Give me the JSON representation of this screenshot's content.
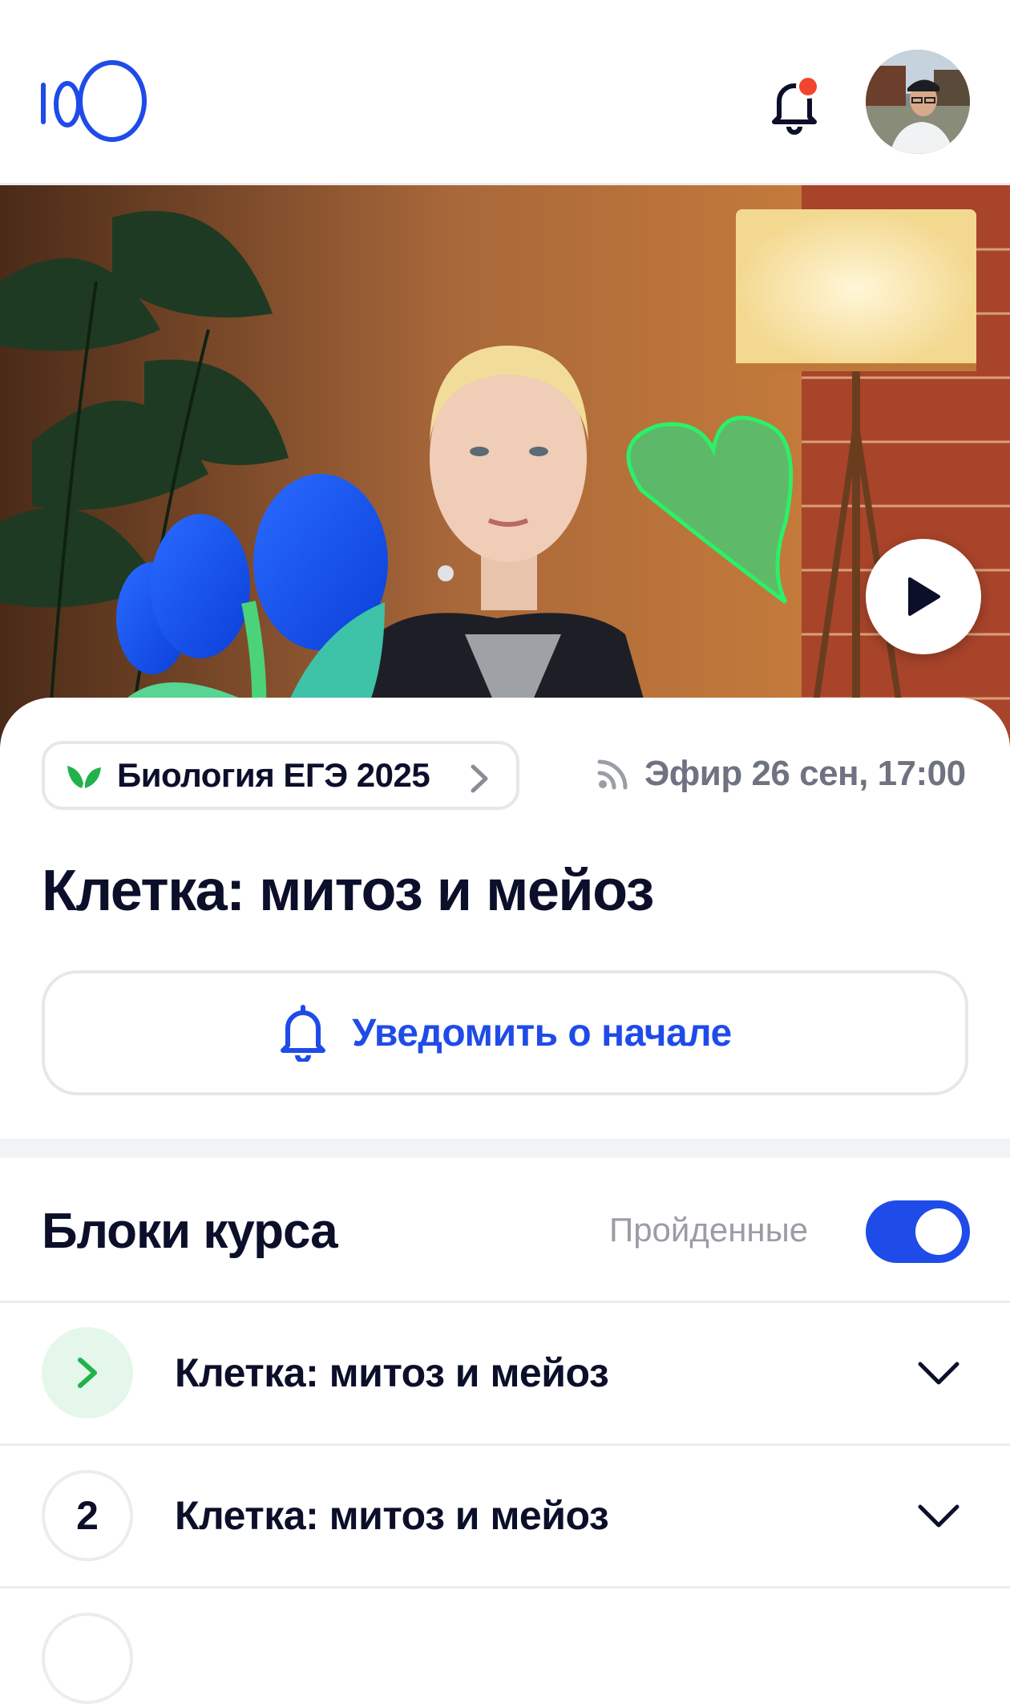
{
  "header": {
    "logo_text": "100",
    "notification_dot_color": "#f2452f"
  },
  "course": {
    "chip_label": "Биология ЕГЭ 2025",
    "air_label": "Эфир 26 сен, 17:00",
    "lesson_title": "Клетка: митоз и мейоз",
    "notify_label": "Уведомить о начале"
  },
  "blocks": {
    "title": "Блоки курса",
    "passed_label": "Пройденные",
    "passed_toggle_on": true,
    "items": [
      {
        "badge": "",
        "status": "current",
        "title": "Клетка: митоз и мейоз"
      },
      {
        "badge": "2",
        "status": "upcoming",
        "title": "Клетка: митоз и мейоз"
      }
    ]
  },
  "colors": {
    "accent": "#1f4be8",
    "green": "#22b24c",
    "text": "#0b0f2a",
    "muted": "#6f7280"
  }
}
